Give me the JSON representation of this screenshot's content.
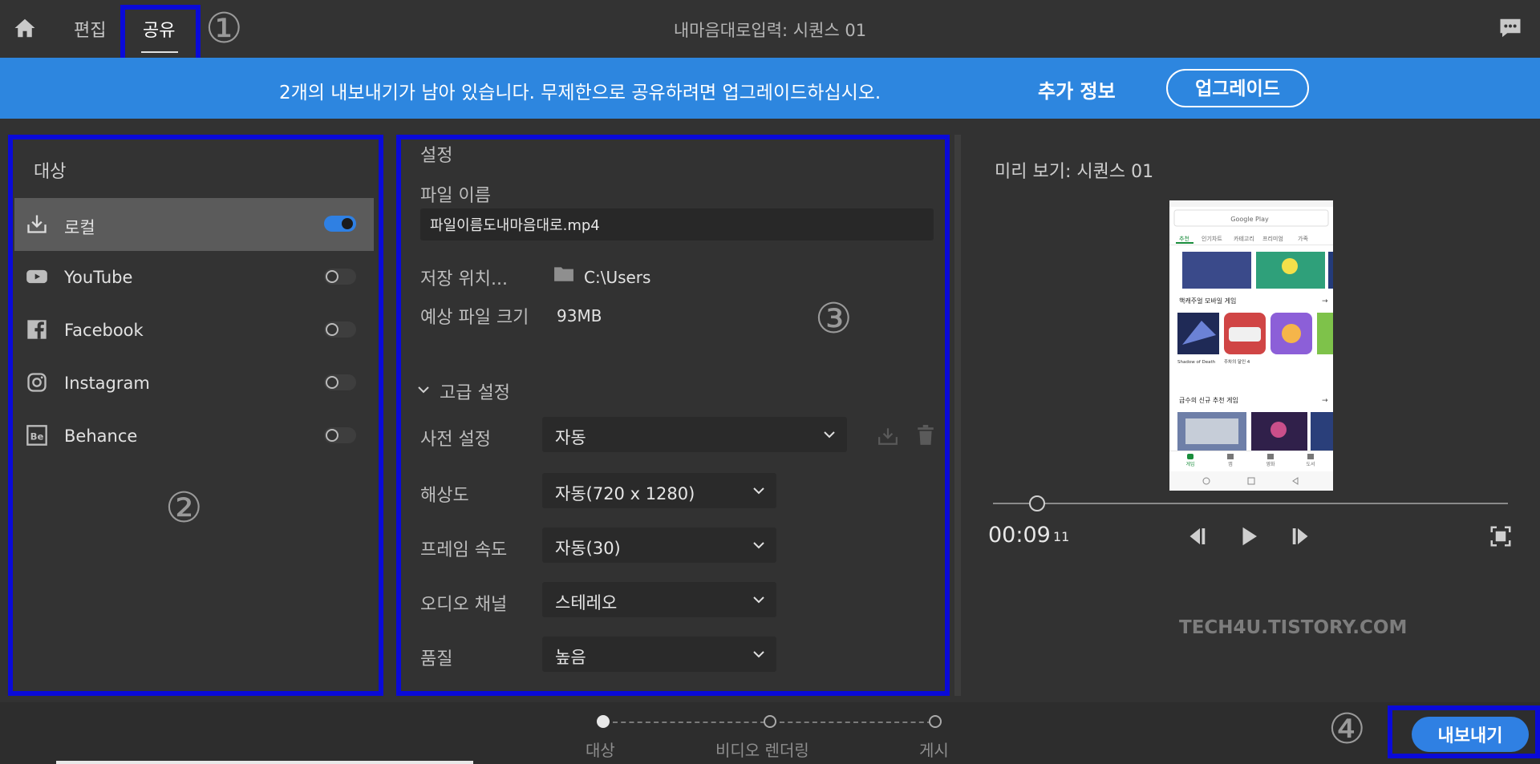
{
  "topbar": {
    "tabs": [
      {
        "label": "편집"
      },
      {
        "label": "공유"
      }
    ],
    "title": "내마음대로입력: 시퀀스 01"
  },
  "banner": {
    "message": "2개의 내보내기가 남아 있습니다. 무제한으로 공유하려면 업그레이드하십시오.",
    "more_info": "추가 정보",
    "upgrade": "업그레이드"
  },
  "destinations": {
    "title": "대상",
    "items": [
      {
        "label": "로컬",
        "icon": "download-icon",
        "enabled": true
      },
      {
        "label": "YouTube",
        "icon": "youtube-icon",
        "enabled": false
      },
      {
        "label": "Facebook",
        "icon": "facebook-icon",
        "enabled": false
      },
      {
        "label": "Instagram",
        "icon": "instagram-icon",
        "enabled": false
      },
      {
        "label": "Behance",
        "icon": "behance-icon",
        "enabled": false
      }
    ]
  },
  "settings": {
    "title": "설정",
    "file_name_label": "파일 이름",
    "file_name_value": "파일이름도내마음대로.mp4",
    "save_location_label": "저장 위치...",
    "save_location_value": "C:\\Users",
    "est_size_label": "예상 파일 크기",
    "est_size_value": "93MB",
    "advanced_label": "고급 설정",
    "preset_label": "사전 설정",
    "preset_value": "자동",
    "resolution_label": "해상도",
    "resolution_value": "자동(720 x 1280)",
    "framerate_label": "프레임 속도",
    "framerate_value": "자동(30)",
    "audio_label": "오디오 채널",
    "audio_value": "스테레오",
    "quality_label": "품질",
    "quality_value": "높음"
  },
  "preview": {
    "title": "미리 보기: 시퀀스 01",
    "timecode": "00:09",
    "frames": "11",
    "playhead_fraction": 0.085,
    "phone": {
      "search": "Google Play",
      "tabs": [
        "추천",
        "인기차트",
        "카테고리",
        "프리미엄",
        "가족"
      ],
      "section1": "핵캐주얼 모바일 게임",
      "section2": "급수의 신규 추천 게임",
      "game1": "Shadow of Death",
      "game2": "주차의 달인 4",
      "nav": [
        "게임",
        "앱",
        "영화",
        "도서"
      ]
    }
  },
  "watermark": "TECH4U.TISTORY.COM",
  "steps": [
    {
      "label": "대상",
      "done": true
    },
    {
      "label": "비디오 렌더링",
      "done": false
    },
    {
      "label": "게시",
      "done": false
    }
  ],
  "export_button": "내보내기",
  "annotations": [
    "①",
    "②",
    "③",
    "④"
  ],
  "colors": {
    "accent": "#2f80e3",
    "banner": "#2d86df",
    "highlight": "#0a0ad8"
  }
}
